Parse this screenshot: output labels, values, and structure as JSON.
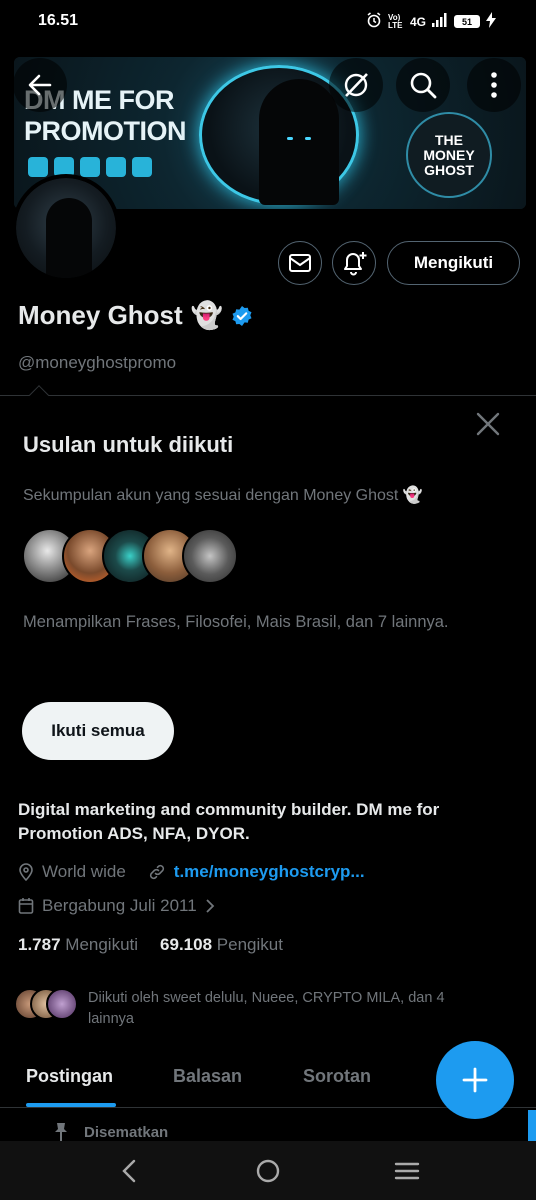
{
  "status_bar": {
    "time": "16.51",
    "network": "4G",
    "volte": "Vo) LTE",
    "battery": "51"
  },
  "banner": {
    "promo_text": "DM ME FOR PROMOTION",
    "logo_text": "THE MONEY GHOST",
    "colors": {
      "accent": "#3dc8e6",
      "background": "#0b1820"
    }
  },
  "profile": {
    "name": "Money Ghost",
    "name_emoji": "👻",
    "handle": "@moneyghostpromo",
    "follow_button": "Mengikuti",
    "bio": "Digital marketing and community builder. DM me for Promotion  ADS, NFA, DYOR.",
    "location": "World wide",
    "website": "t.me/moneyghostcryp...",
    "joined": "Bergabung Juli 2011",
    "following_count": "1.787",
    "following_label": "Mengikuti",
    "followers_count": "69.108",
    "followers_label": "Pengikut",
    "followed_by": "Diikuti oleh sweet delulu, Nueee, CRYPTO MILA, dan 4 lainnya"
  },
  "suggestions": {
    "title": "Usulan untuk diikuti",
    "subtitle": "Sekumpulan akun yang sesuai dengan Money Ghost 👻",
    "description": "Menampilkan Frases, Filosofei, Mais Brasil, dan 7 lainnya.",
    "follow_all": "Ikuti semua"
  },
  "tabs": [
    {
      "label": "Postingan",
      "active": true
    },
    {
      "label": "Balasan",
      "active": false
    },
    {
      "label": "Sorotan",
      "active": false
    }
  ],
  "pinned_label": "Disematkan",
  "colors": {
    "brand_blue": "#1d9bf0",
    "background": "#000000",
    "muted_text": "#71767b"
  }
}
